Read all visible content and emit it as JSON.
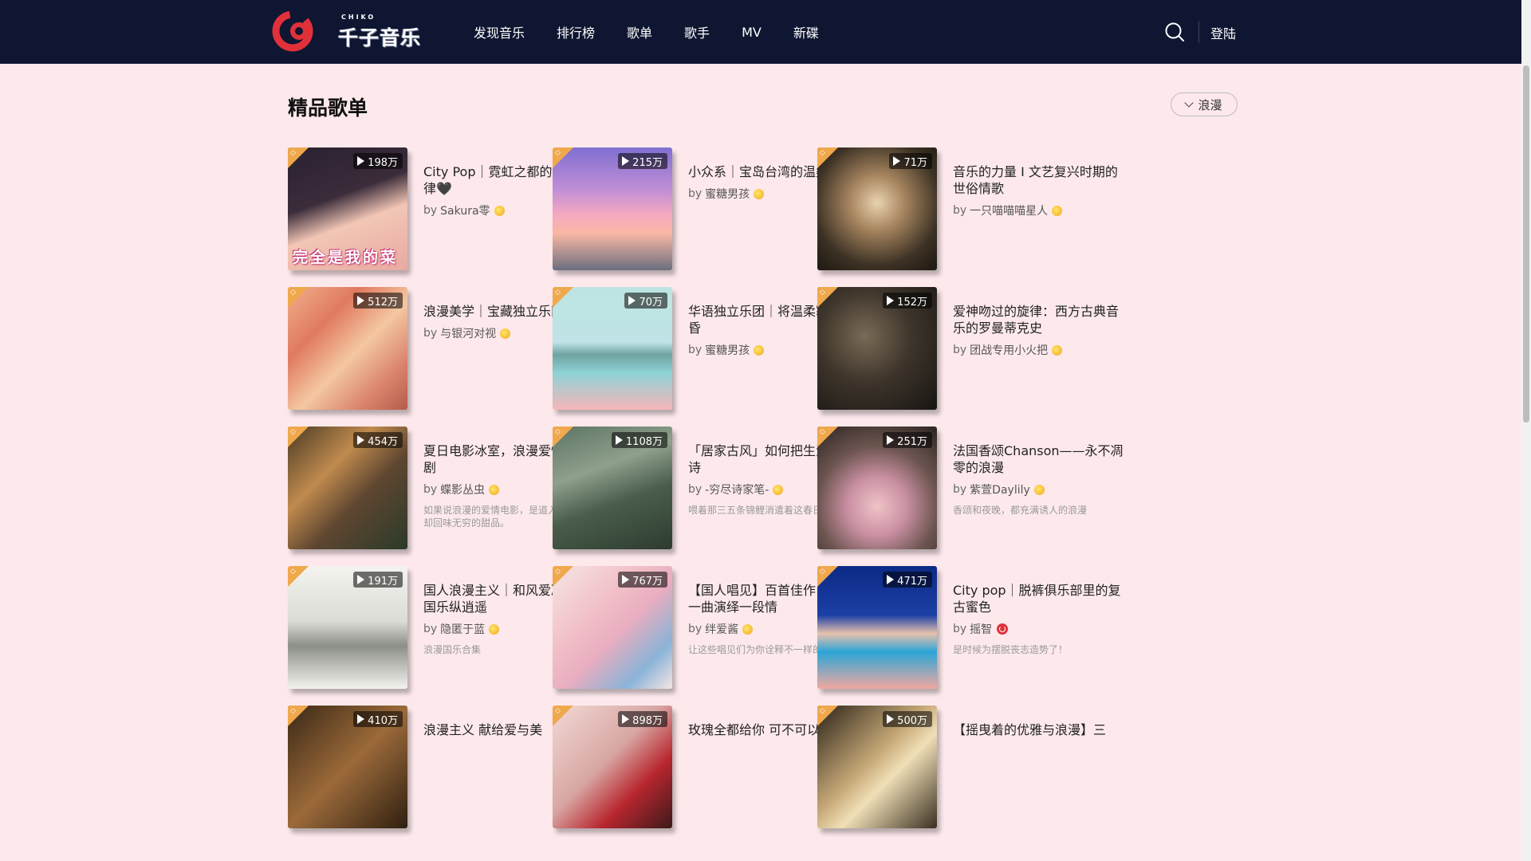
{
  "brand": {
    "sub": "CHIKO",
    "name": "千子音乐"
  },
  "nav": [
    "发现音乐",
    "排行榜",
    "歌单",
    "歌手",
    "MV",
    "新碟"
  ],
  "header": {
    "login": "登陆"
  },
  "page": {
    "title": "精品歌单",
    "filter": "浪漫"
  },
  "colors": {
    "header_bg": "#0e1631",
    "page_bg": "#fde9ec",
    "accent_red": "#e0303a",
    "corner": "#f0a84d"
  },
  "playlists": [
    {
      "plays": "198万",
      "title": "City Pop｜霓虹之都的浪漫旋律🖤",
      "creator": "Sakura零",
      "badge": "star",
      "desc": "",
      "cover_text": "完全是我的菜"
    },
    {
      "plays": "215万",
      "title": "小众系｜宝岛台湾的温柔海风",
      "creator": "蜜糖男孩",
      "badge": "star",
      "desc": ""
    },
    {
      "plays": "71万",
      "title": "音乐的力量 I 文艺复兴时期的世俗情歌",
      "creator": "一只喵喵喵星人",
      "badge": "star",
      "desc": ""
    },
    {
      "plays": "512万",
      "title": "浪漫美学｜宝藏独立乐队指南",
      "creator": "与银河对视",
      "badge": "star",
      "desc": ""
    },
    {
      "plays": "70万",
      "title": "华语独立乐团｜将温柔塞满黄昏",
      "creator": "蜜糖男孩",
      "badge": "star",
      "desc": ""
    },
    {
      "plays": "152万",
      "title": "爱神吻过的旋律：西方古典音乐的罗曼蒂克史",
      "creator": "团战专用小火把",
      "badge": "star",
      "desc": ""
    },
    {
      "plays": "454万",
      "title": "夏日电影冰室，浪漫爱情轻喜剧",
      "creator": "蝶影丛虫",
      "badge": "star",
      "desc": "如果说浪漫的爱情电影，是道入口即化却回味无穷的甜品。"
    },
    {
      "plays": "1108万",
      "title": "「居家古风」如何把生活过成诗",
      "creator": "-穷尽诗家笔-",
      "badge": "star",
      "desc": "喂着那三五条锦鲤消遣着这春日时光"
    },
    {
      "plays": "251万",
      "title": "法国香颂Chanson——永不凋零的浪漫",
      "creator": "紫萱Daylily",
      "badge": "star",
      "desc": "香颂和夜晚，都充满诱人的浪漫"
    },
    {
      "plays": "191万",
      "title": "国人浪漫主义｜和风爱凄雅，国乐纵逍遥",
      "creator": "隐匿于蓝",
      "badge": "star",
      "desc": "浪漫国乐合集"
    },
    {
      "plays": "767万",
      "title": "【国人唱见】百首佳作，一人一曲演绎一段情",
      "creator": "绊爱酱",
      "badge": "star",
      "desc": "让这些唱见们为你诠释不一样的浪漫。"
    },
    {
      "plays": "471万",
      "title": "City pop｜脱裤俱乐部里的复古蜜色",
      "creator": "摇智",
      "badge": "red",
      "desc": "是时候为摆脱丧志造势了！"
    },
    {
      "plays": "410万",
      "title": "浪漫主义 献给爱与美",
      "creator": "",
      "badge": "",
      "desc": ""
    },
    {
      "plays": "898万",
      "title": "玫瑰全都给你 可不可以把你",
      "creator": "",
      "badge": "",
      "desc": ""
    },
    {
      "plays": "500万",
      "title": "【摇曳着的优雅与浪漫】三",
      "creator": "",
      "badge": "",
      "desc": ""
    }
  ]
}
